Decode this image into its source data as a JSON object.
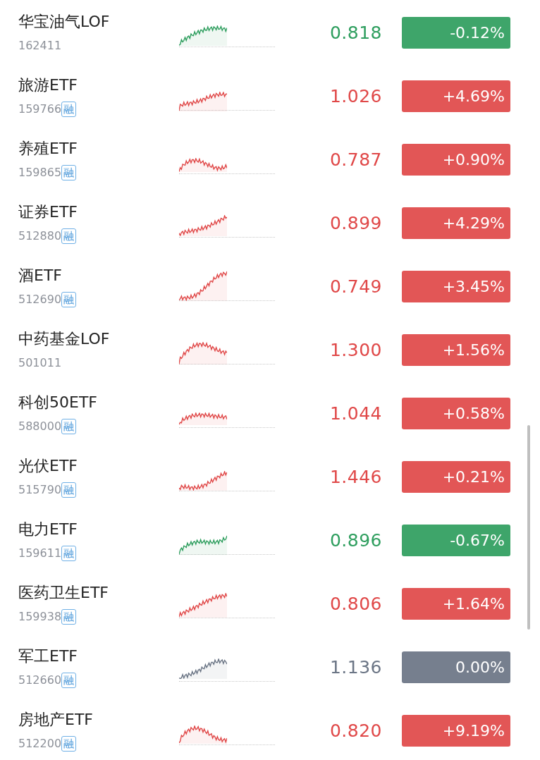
{
  "funds": [
    {
      "name": "华宝油气LOF",
      "code": "162411",
      "color": "#2e9e5e",
      "price": "0.818",
      "change": "-0.12%"
    },
    {
      "name": "旅游ETF",
      "code": "159766",
      "badge": "融",
      "color": "#e04848",
      "price": "1.026",
      "change": "+4.69%"
    },
    {
      "name": "养殖ETF",
      "code": "159865",
      "badge": "融",
      "color": "#e04848",
      "price": "0.787",
      "change": "+0.90%"
    },
    {
      "name": "证券ETF",
      "code": "512880",
      "badge": "融",
      "color": "#e04848",
      "price": "0.899",
      "change": "+4.29%"
    },
    {
      "name": "酒ETF",
      "code": "512690",
      "badge": "融",
      "color": "#e04848",
      "price": "0.749",
      "change": "+3.45%"
    },
    {
      "name": "中药基金LOF",
      "code": "501011",
      "color": "#e04848",
      "price": "1.300",
      "change": "+1.56%"
    },
    {
      "name": "科创50ETF",
      "code": "588000",
      "badge": "融",
      "color": "#e04848",
      "price": "1.044",
      "change": "+0.58%"
    },
    {
      "name": "光伏ETF",
      "code": "515790",
      "badge": "融",
      "color": "#e04848",
      "price": "1.446",
      "change": "+0.21%"
    },
    {
      "name": "电力ETF",
      "code": "159611",
      "badge": "融",
      "color": "#2e9e5e",
      "price": "0.896",
      "change": "-0.67%"
    },
    {
      "name": "医药卫生ETF",
      "code": "159938",
      "badge": "融",
      "color": "#e04848",
      "price": "0.806",
      "change": "+1.64%"
    },
    {
      "name": "军工ETF",
      "code": "512660",
      "badge": "融",
      "color": "#6b7585",
      "price": "1.136",
      "change": "0.00%"
    },
    {
      "name": "房地产ETF",
      "code": "512200",
      "badge": "融",
      "color": "#e04848",
      "price": "0.820",
      "change": "+9.19%"
    }
  ]
}
